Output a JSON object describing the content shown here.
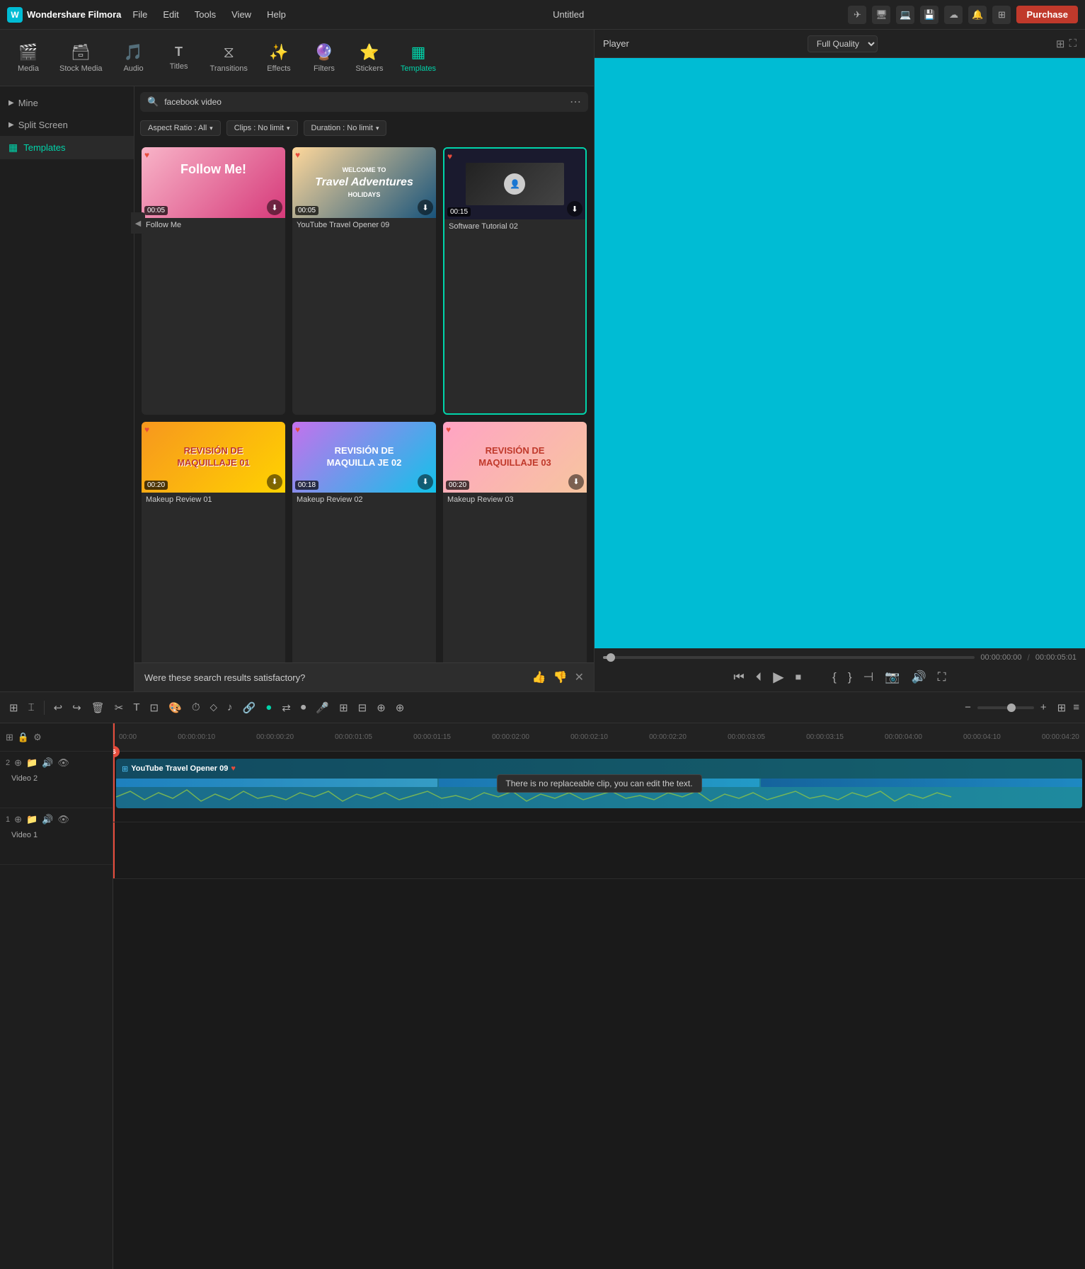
{
  "app": {
    "name": "Wondershare Filmora",
    "title": "Untitled",
    "logo_char": "W"
  },
  "menu": {
    "items": [
      "File",
      "Edit",
      "Tools",
      "View",
      "Help"
    ]
  },
  "purchase": {
    "label": "Purchase"
  },
  "tabs": [
    {
      "id": "media",
      "label": "Media",
      "icon": "🎬"
    },
    {
      "id": "stock_media",
      "label": "Stock Media",
      "icon": "🗃"
    },
    {
      "id": "audio",
      "label": "Audio",
      "icon": "🎵"
    },
    {
      "id": "titles",
      "label": "Titles",
      "icon": "T"
    },
    {
      "id": "transitions",
      "label": "Transitions",
      "icon": "⧖"
    },
    {
      "id": "effects",
      "label": "Effects",
      "icon": "✨"
    },
    {
      "id": "filters",
      "label": "Filters",
      "icon": "🔮"
    },
    {
      "id": "stickers",
      "label": "Stickers",
      "icon": "⭐"
    },
    {
      "id": "templates",
      "label": "Templates",
      "icon": "▦"
    }
  ],
  "sidebar": {
    "items": [
      {
        "id": "mine",
        "label": "Mine",
        "icon": "▶"
      },
      {
        "id": "split_screen",
        "label": "Split Screen",
        "icon": "▶"
      },
      {
        "id": "templates",
        "label": "Templates",
        "icon": "▦"
      }
    ]
  },
  "search": {
    "placeholder": "facebook video",
    "value": "facebook video"
  },
  "filters": {
    "aspect_ratio": "Aspect Ratio : All",
    "clips": "Clips : No limit",
    "duration": "Duration : No limit"
  },
  "templates": [
    {
      "id": "follow_me",
      "label": "Follow Me",
      "duration": "00:05",
      "thumb_class": "follow-me-thumb",
      "thumb_text": "Follow Me!",
      "border": false
    },
    {
      "id": "yt_travel",
      "label": "YouTube Travel Opener 09",
      "duration": "00:05",
      "thumb_class": "travel-thumb",
      "thumb_text": "WELCOME TO\nTravel Adventures\nHOLIDAYS",
      "border": false
    },
    {
      "id": "software_tutorial",
      "label": "Software Tutorial 02",
      "duration": "00:15",
      "thumb_class": "tutorial-thumb",
      "thumb_text": "",
      "border": true
    },
    {
      "id": "makeup1",
      "label": "Makeup Review 01",
      "duration": "00:20",
      "thumb_class": "makeup1-thumb",
      "thumb_text": "REVISIÓN DE\nMAQUILLAJE 01",
      "border": false
    },
    {
      "id": "makeup2",
      "label": "Makeup Review 02",
      "duration": "00:18",
      "thumb_class": "makeup2-thumb",
      "thumb_text": "REVISIÓN DE\nMAQUILLA JE 02",
      "border": false
    },
    {
      "id": "makeup3",
      "label": "Makeup Review 03",
      "duration": "00:20",
      "thumb_class": "makeup3-thumb",
      "thumb_text": "REVISIÓN DE\nMAQUILLAJE 03",
      "border": false
    }
  ],
  "feedback": {
    "text": "Were these search results satisfactory?"
  },
  "player": {
    "label": "Player",
    "quality": "Full Quality",
    "time_current": "00:00:00:00",
    "time_total": "00:00:05:01"
  },
  "timeline": {
    "clip_label": "YouTube Travel Opener 09",
    "tooltip": "There is no replaceable clip, you can edit the text.",
    "track_labels": [
      {
        "id": "video2",
        "label": "Video 2",
        "num": "2"
      },
      {
        "id": "video1",
        "label": "Video 1",
        "num": "1"
      }
    ],
    "ruler_times": [
      "00:00",
      "00:00:00:10",
      "00:00:00:20",
      "00:00:01:05",
      "00:00:01:15",
      "00:00:02:00",
      "00:00:02:10",
      "00:00:02:20",
      "00:00:03:05",
      "00:00:03:15",
      "00:00:04:00",
      "00:00:04:10",
      "00:00:04:20"
    ]
  }
}
